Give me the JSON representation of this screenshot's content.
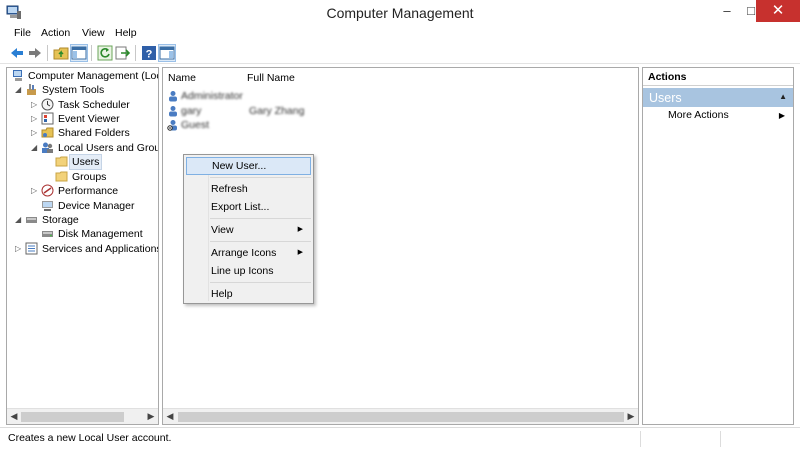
{
  "window": {
    "title": "Computer Management",
    "minimize_glyph": "–",
    "maximize_glyph": "□",
    "close_glyph": "✕"
  },
  "menu": [
    "File",
    "Action",
    "View",
    "Help"
  ],
  "toolbar_icons": [
    "back-arrow-icon",
    "forward-arrow-icon",
    "up-folder-icon",
    "show-hide-tree-icon",
    "refresh-icon",
    "export-list-icon",
    "help-icon",
    "show-hide-action-pane-icon"
  ],
  "tree": {
    "root": "Computer Management (Local",
    "system_tools": "System Tools",
    "task_scheduler": "Task Scheduler",
    "event_viewer": "Event Viewer",
    "shared_folders": "Shared Folders",
    "local_users_groups": "Local Users and Groups",
    "users": "Users",
    "groups": "Groups",
    "performance": "Performance",
    "device_manager": "Device Manager",
    "storage": "Storage",
    "disk_management": "Disk Management",
    "services_apps": "Services and Applications",
    "selected": "Users"
  },
  "list": {
    "columns": [
      "Name",
      "Full Name"
    ],
    "rows": [
      {
        "name": "Administrator",
        "full_name": ""
      },
      {
        "name": "gary",
        "full_name": "Gary Zhang"
      },
      {
        "name": "Guest",
        "full_name": ""
      }
    ]
  },
  "context_menu": {
    "items": [
      "New User...",
      "Refresh",
      "Export List...",
      "View",
      "Arrange Icons",
      "Line up Icons",
      "Help"
    ],
    "highlighted": "New User...",
    "submenu_arrow": "▶"
  },
  "actions": {
    "header": "Actions",
    "group": "Users",
    "group_caret": "▲",
    "item": "More Actions",
    "item_arrow": "▶"
  },
  "status": {
    "text": "Creates a new Local User account."
  },
  "colors": {
    "close_button": "#c7312e",
    "actions_group_bg": "#a8c4e0",
    "menu_highlight": "#dbe8f7",
    "menu_highlight_border": "#7fb0e3"
  }
}
